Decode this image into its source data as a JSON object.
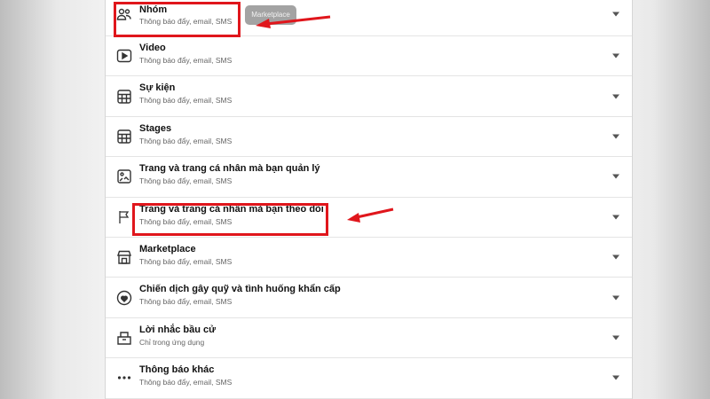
{
  "tooltip": "Marketplace",
  "items": [
    {
      "icon": "group-icon",
      "title": "Nhóm",
      "subtitle": "Thông báo đẩy, email, SMS"
    },
    {
      "icon": "video-icon",
      "title": "Video",
      "subtitle": "Thông báo đẩy, email, SMS"
    },
    {
      "icon": "calendar-icon",
      "title": "Sự kiện",
      "subtitle": "Thông báo đẩy, email, SMS"
    },
    {
      "icon": "calendar-icon",
      "title": "Stages",
      "subtitle": "Thông báo đẩy, email, SMS"
    },
    {
      "icon": "manage-page-icon",
      "title": "Trang và trang cá nhân mà bạn quản lý",
      "subtitle": "Thông báo đẩy, email, SMS"
    },
    {
      "icon": "flag-icon",
      "title": "Trang và trang cá nhân mà bạn theo dõi",
      "subtitle": "Thông báo đẩy, email, SMS"
    },
    {
      "icon": "store-icon",
      "title": "Marketplace",
      "subtitle": "Thông báo đẩy, email, SMS"
    },
    {
      "icon": "fundraiser-icon",
      "title": "Chiến dịch gây quỹ và tình huống khẩn cấp",
      "subtitle": "Thông báo đẩy, email, SMS"
    },
    {
      "icon": "ballot-icon",
      "title": "Lời nhắc bầu cử",
      "subtitle": "Chỉ trong ứng dụng"
    },
    {
      "icon": "more-icon",
      "title": "Thông báo khác",
      "subtitle": "Thông báo đẩy, email, SMS"
    }
  ],
  "annotation_color": "#e0161c"
}
